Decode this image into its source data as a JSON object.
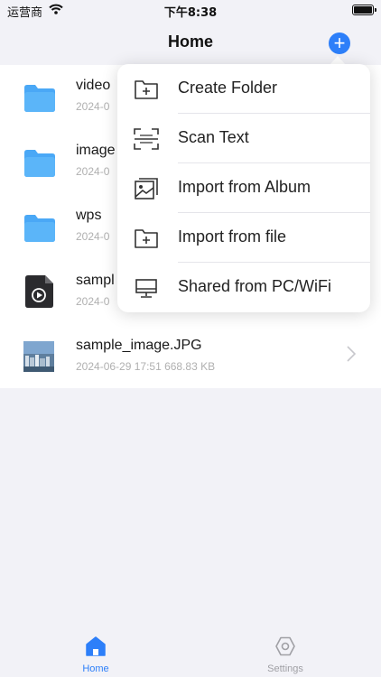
{
  "status_bar": {
    "carrier": "运营商",
    "time": "下午8:38"
  },
  "nav": {
    "title": "Home",
    "add_symbol": "+"
  },
  "files": [
    {
      "name": "video",
      "meta": "2024-0",
      "icon": "folder-icon"
    },
    {
      "name": "image",
      "meta": "2024-0",
      "icon": "folder-icon"
    },
    {
      "name": "wps",
      "meta": "2024-0",
      "icon": "folder-icon"
    },
    {
      "name": "sampl",
      "meta": "2024-0",
      "icon": "video-file-icon"
    },
    {
      "name": "sample_image.JPG",
      "meta": "2024-06-29 17:51  668.83 KB",
      "icon": "image-thumbnail"
    }
  ],
  "menu": {
    "items": [
      {
        "label": "Create Folder",
        "icon": "folder-plus-icon"
      },
      {
        "label": "Scan Text",
        "icon": "scan-icon"
      },
      {
        "label": "Import from Album",
        "icon": "photo-icon"
      },
      {
        "label": "Import from file",
        "icon": "file-plus-icon"
      },
      {
        "label": "Shared from PC/WiFi",
        "icon": "monitor-icon"
      }
    ]
  },
  "tabs": [
    {
      "label": "Home",
      "icon": "home-icon",
      "active": true
    },
    {
      "label": "Settings",
      "icon": "settings-icon",
      "active": false
    }
  ],
  "colors": {
    "accent": "#2d7ff9",
    "folder": "#4aa8f6",
    "inactive": "#a0a0a5"
  }
}
